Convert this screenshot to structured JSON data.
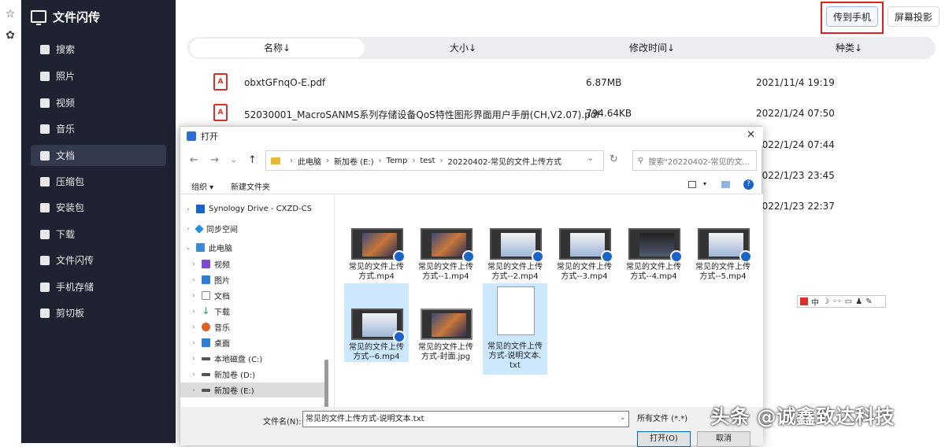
{
  "app": {
    "title": "文件闪传"
  },
  "strip": {
    "icons": [
      "star-icon",
      "settings-icon"
    ]
  },
  "sidebar": {
    "items": [
      {
        "label": "搜索",
        "icon": "search-icon"
      },
      {
        "label": "照片",
        "icon": "photo-icon"
      },
      {
        "label": "视频",
        "icon": "video-icon"
      },
      {
        "label": "音乐",
        "icon": "music-icon"
      },
      {
        "label": "文档",
        "icon": "document-icon",
        "active": true
      },
      {
        "label": "压缩包",
        "icon": "archive-icon"
      },
      {
        "label": "安装包",
        "icon": "package-icon"
      },
      {
        "label": "下载",
        "icon": "download-icon"
      },
      {
        "label": "文件闪传",
        "icon": "folder-icon"
      },
      {
        "label": "手机存储",
        "icon": "phone-icon"
      },
      {
        "label": "剪切板",
        "icon": "clipboard-icon"
      }
    ]
  },
  "toolbar": {
    "send_to_phone": "传到手机",
    "screen_cast": "屏幕投影"
  },
  "columns": {
    "name": "名称↓",
    "size": "大小↓",
    "modified": "修改时间↓",
    "type": "种类↓"
  },
  "files": [
    {
      "name": "obxtGFnqO-E.pdf",
      "size": "6.87MB",
      "date": "2021/11/4 19:19"
    },
    {
      "name": "52030001_MacroSANMS系列存储设备QoS特性图形界面用户手册(CH,V2.07).pdf",
      "size": "794.64KB",
      "date": "2022/1/24 07:50"
    },
    {
      "date": "2022/1/24 07:44"
    },
    {
      "date": "2022/1/23 23:45"
    },
    {
      "date": "2022/1/23 22:37"
    }
  ],
  "dialog": {
    "title": "打开",
    "path": [
      "此电脑",
      "新加卷 (E:)",
      "Temp",
      "test",
      "20220402-常见的文件上传方式"
    ],
    "search_placeholder": "搜索\"20220402-常见的文...",
    "organize": "组织 ▾",
    "new_folder": "新建文件夹",
    "tree": [
      {
        "label": "Synology Drive - CXZD-CS",
        "icon_color": "#1a63c9"
      },
      {
        "label": "同步空间",
        "icon_color": "#2a90e0"
      },
      {
        "label": "此电脑",
        "icon_color": "#3a8ad6",
        "expanded": true
      },
      {
        "label": "视频",
        "icon_color": "#7b4fc8"
      },
      {
        "label": "图片",
        "icon_color": "#2f7fd0"
      },
      {
        "label": "文档",
        "icon_color": "#8a8a8a"
      },
      {
        "label": "下载",
        "icon_color": "#2a9d5a"
      },
      {
        "label": "音乐",
        "icon_color": "#e0602a"
      },
      {
        "label": "桌面",
        "icon_color": "#2f7fd0"
      },
      {
        "label": "本地磁盘 (C:)",
        "icon_color": "#555555"
      },
      {
        "label": "新加卷 (D:)",
        "icon_color": "#555555"
      },
      {
        "label": "新加卷 (E:)",
        "icon_color": "#555555",
        "selected": true
      }
    ],
    "thumbs": [
      {
        "l1": "常见的文件上传",
        "l2": "方式.mp4",
        "kind": "video"
      },
      {
        "l1": "常见的文件上传",
        "l2": "方式--1.mp4",
        "kind": "video"
      },
      {
        "l1": "常见的文件上传",
        "l2": "方式--2.mp4",
        "kind": "video-light"
      },
      {
        "l1": "常见的文件上传",
        "l2": "方式--3.mp4",
        "kind": "video-light"
      },
      {
        "l1": "常见的文件上传",
        "l2": "方式--4.mp4",
        "kind": "video-dark"
      },
      {
        "l1": "常见的文件上传",
        "l2": "方式--5.mp4",
        "kind": "video-light"
      },
      {
        "l1": "常见的文件上传",
        "l2": "方式--6.mp4",
        "kind": "video-light",
        "selected": true
      },
      {
        "l1": "常见的文件上传",
        "l2": "方式-封面.jpg",
        "kind": "image"
      },
      {
        "l1": "常见的文件上传",
        "l2": "方式-说明文本.",
        "l3": "txt",
        "kind": "doc",
        "selected": true
      }
    ],
    "filename_label": "文件名(N):",
    "filename_value": "常见的文件上传方式-说明文本.txt",
    "filetype": "所有文件 (*.*)",
    "open": "打开(O)",
    "cancel": "取消"
  },
  "ime": {
    "text": "中"
  },
  "watermark": "头条 @诚鑫致达科技"
}
